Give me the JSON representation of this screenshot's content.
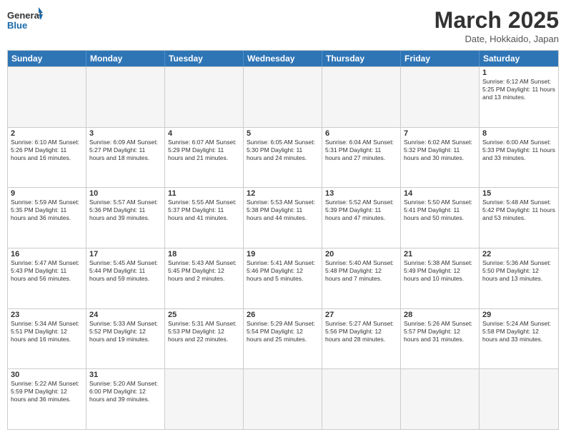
{
  "header": {
    "logo_general": "General",
    "logo_blue": "Blue",
    "month_title": "March 2025",
    "subtitle": "Date, Hokkaido, Japan"
  },
  "day_headers": [
    "Sunday",
    "Monday",
    "Tuesday",
    "Wednesday",
    "Thursday",
    "Friday",
    "Saturday"
  ],
  "weeks": [
    [
      {
        "day": "",
        "info": ""
      },
      {
        "day": "",
        "info": ""
      },
      {
        "day": "",
        "info": ""
      },
      {
        "day": "",
        "info": ""
      },
      {
        "day": "",
        "info": ""
      },
      {
        "day": "",
        "info": ""
      },
      {
        "day": "1",
        "info": "Sunrise: 6:12 AM\nSunset: 5:25 PM\nDaylight: 11 hours and 13 minutes."
      }
    ],
    [
      {
        "day": "2",
        "info": "Sunrise: 6:10 AM\nSunset: 5:26 PM\nDaylight: 11 hours and 16 minutes."
      },
      {
        "day": "3",
        "info": "Sunrise: 6:09 AM\nSunset: 5:27 PM\nDaylight: 11 hours and 18 minutes."
      },
      {
        "day": "4",
        "info": "Sunrise: 6:07 AM\nSunset: 5:29 PM\nDaylight: 11 hours and 21 minutes."
      },
      {
        "day": "5",
        "info": "Sunrise: 6:05 AM\nSunset: 5:30 PM\nDaylight: 11 hours and 24 minutes."
      },
      {
        "day": "6",
        "info": "Sunrise: 6:04 AM\nSunset: 5:31 PM\nDaylight: 11 hours and 27 minutes."
      },
      {
        "day": "7",
        "info": "Sunrise: 6:02 AM\nSunset: 5:32 PM\nDaylight: 11 hours and 30 minutes."
      },
      {
        "day": "8",
        "info": "Sunrise: 6:00 AM\nSunset: 5:33 PM\nDaylight: 11 hours and 33 minutes."
      }
    ],
    [
      {
        "day": "9",
        "info": "Sunrise: 5:59 AM\nSunset: 5:35 PM\nDaylight: 11 hours and 36 minutes."
      },
      {
        "day": "10",
        "info": "Sunrise: 5:57 AM\nSunset: 5:36 PM\nDaylight: 11 hours and 39 minutes."
      },
      {
        "day": "11",
        "info": "Sunrise: 5:55 AM\nSunset: 5:37 PM\nDaylight: 11 hours and 41 minutes."
      },
      {
        "day": "12",
        "info": "Sunrise: 5:53 AM\nSunset: 5:38 PM\nDaylight: 11 hours and 44 minutes."
      },
      {
        "day": "13",
        "info": "Sunrise: 5:52 AM\nSunset: 5:39 PM\nDaylight: 11 hours and 47 minutes."
      },
      {
        "day": "14",
        "info": "Sunrise: 5:50 AM\nSunset: 5:41 PM\nDaylight: 11 hours and 50 minutes."
      },
      {
        "day": "15",
        "info": "Sunrise: 5:48 AM\nSunset: 5:42 PM\nDaylight: 11 hours and 53 minutes."
      }
    ],
    [
      {
        "day": "16",
        "info": "Sunrise: 5:47 AM\nSunset: 5:43 PM\nDaylight: 11 hours and 56 minutes."
      },
      {
        "day": "17",
        "info": "Sunrise: 5:45 AM\nSunset: 5:44 PM\nDaylight: 11 hours and 59 minutes."
      },
      {
        "day": "18",
        "info": "Sunrise: 5:43 AM\nSunset: 5:45 PM\nDaylight: 12 hours and 2 minutes."
      },
      {
        "day": "19",
        "info": "Sunrise: 5:41 AM\nSunset: 5:46 PM\nDaylight: 12 hours and 5 minutes."
      },
      {
        "day": "20",
        "info": "Sunrise: 5:40 AM\nSunset: 5:48 PM\nDaylight: 12 hours and 7 minutes."
      },
      {
        "day": "21",
        "info": "Sunrise: 5:38 AM\nSunset: 5:49 PM\nDaylight: 12 hours and 10 minutes."
      },
      {
        "day": "22",
        "info": "Sunrise: 5:36 AM\nSunset: 5:50 PM\nDaylight: 12 hours and 13 minutes."
      }
    ],
    [
      {
        "day": "23",
        "info": "Sunrise: 5:34 AM\nSunset: 5:51 PM\nDaylight: 12 hours and 16 minutes."
      },
      {
        "day": "24",
        "info": "Sunrise: 5:33 AM\nSunset: 5:52 PM\nDaylight: 12 hours and 19 minutes."
      },
      {
        "day": "25",
        "info": "Sunrise: 5:31 AM\nSunset: 5:53 PM\nDaylight: 12 hours and 22 minutes."
      },
      {
        "day": "26",
        "info": "Sunrise: 5:29 AM\nSunset: 5:54 PM\nDaylight: 12 hours and 25 minutes."
      },
      {
        "day": "27",
        "info": "Sunrise: 5:27 AM\nSunset: 5:56 PM\nDaylight: 12 hours and 28 minutes."
      },
      {
        "day": "28",
        "info": "Sunrise: 5:26 AM\nSunset: 5:57 PM\nDaylight: 12 hours and 31 minutes."
      },
      {
        "day": "29",
        "info": "Sunrise: 5:24 AM\nSunset: 5:58 PM\nDaylight: 12 hours and 33 minutes."
      }
    ],
    [
      {
        "day": "30",
        "info": "Sunrise: 5:22 AM\nSunset: 5:59 PM\nDaylight: 12 hours and 36 minutes."
      },
      {
        "day": "31",
        "info": "Sunrise: 5:20 AM\nSunset: 6:00 PM\nDaylight: 12 hours and 39 minutes."
      },
      {
        "day": "",
        "info": ""
      },
      {
        "day": "",
        "info": ""
      },
      {
        "day": "",
        "info": ""
      },
      {
        "day": "",
        "info": ""
      },
      {
        "day": "",
        "info": ""
      }
    ]
  ]
}
